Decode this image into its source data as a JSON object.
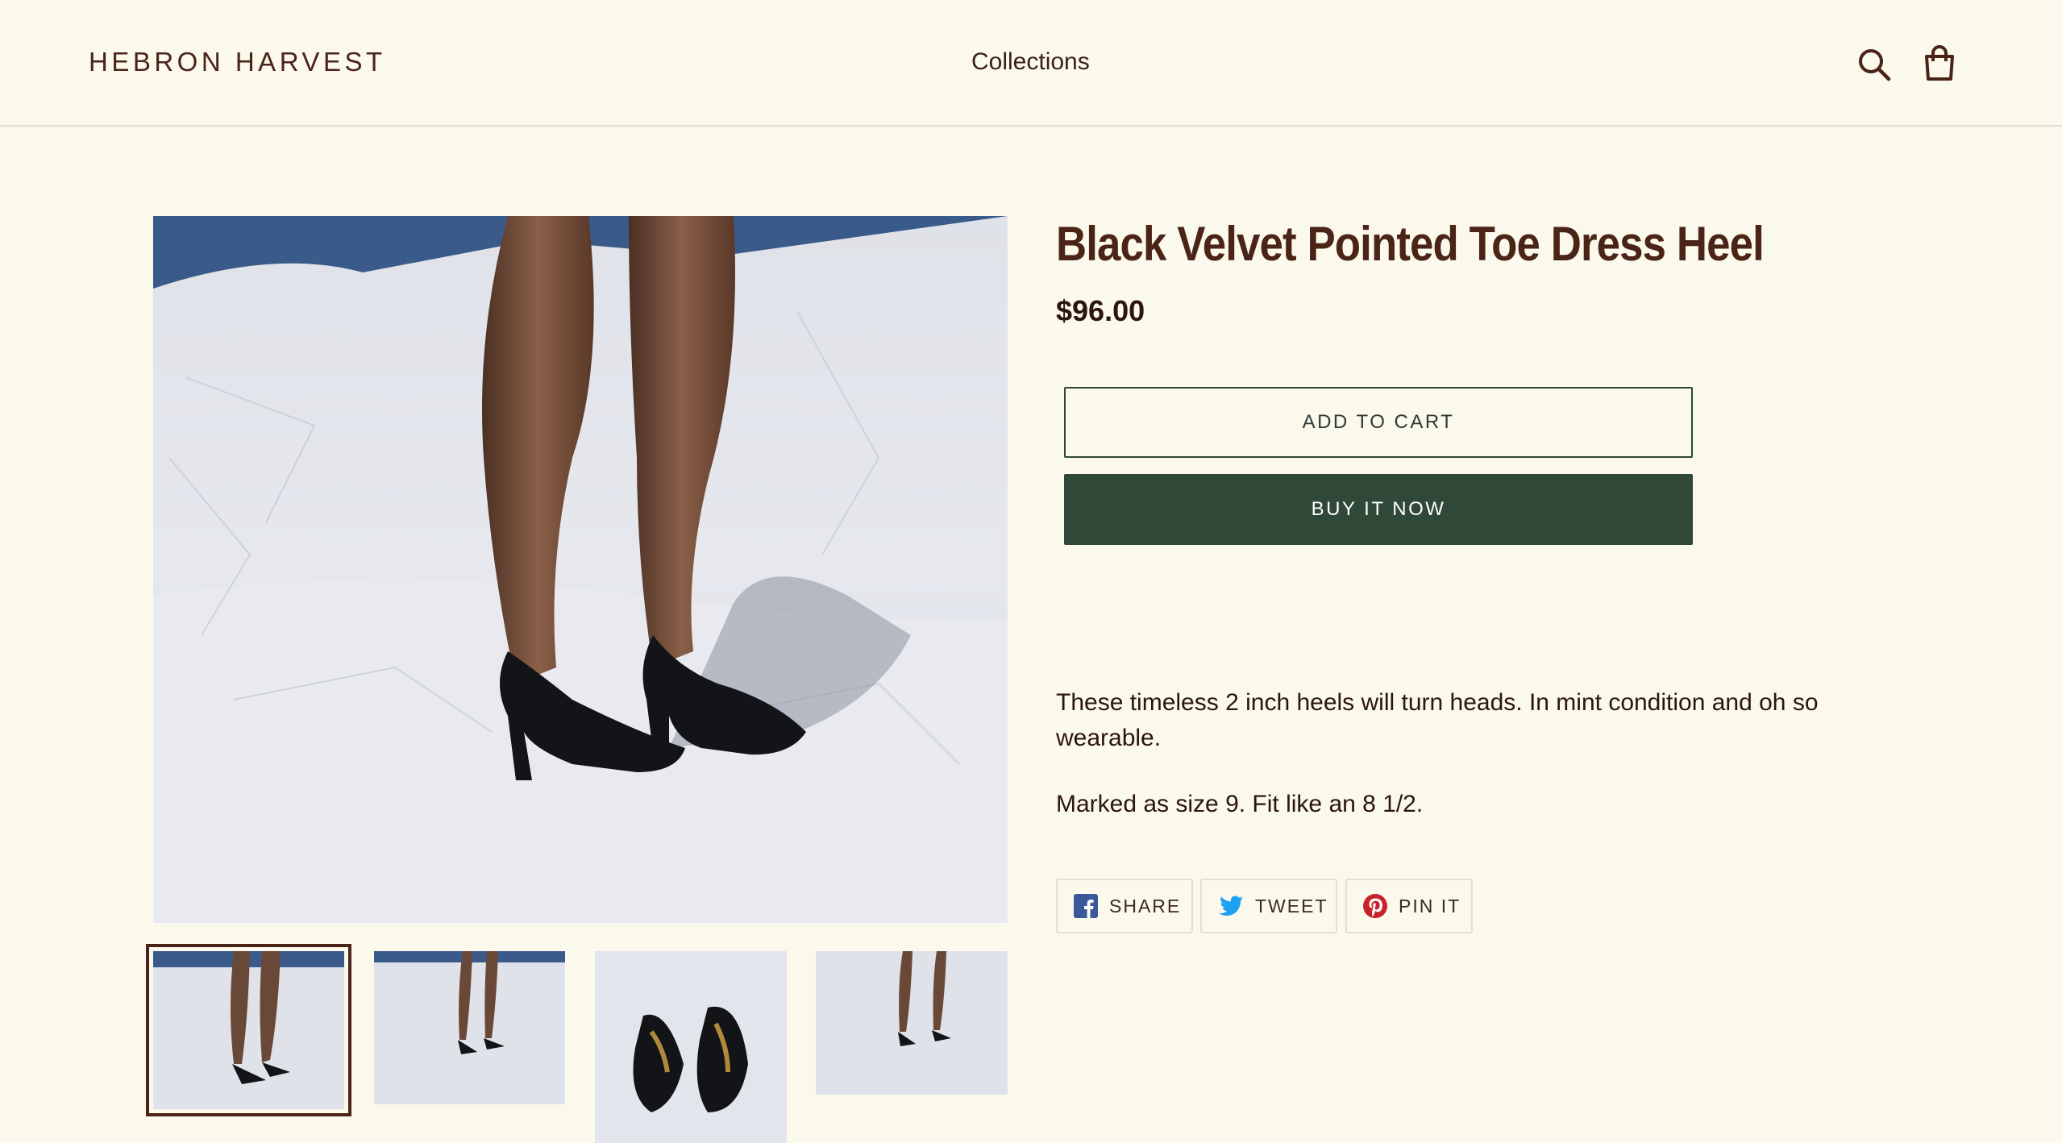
{
  "header": {
    "logo": "HEBRON HARVEST",
    "nav": [
      "Collections"
    ]
  },
  "product": {
    "title": "Black Velvet Pointed Toe Dress Heel",
    "price": "$96.00",
    "add_to_cart": "ADD TO CART",
    "buy_now": "BUY IT NOW",
    "description": [
      "These timeless 2 inch heels will turn heads. In mint condition and oh so wearable.",
      "Marked as size 9. Fit like an 8 1/2."
    ]
  },
  "share": {
    "facebook": "SHARE",
    "twitter": "TWEET",
    "pinterest": "PIN IT"
  },
  "colors": {
    "background": "#fbf8ec",
    "brand_brown": "#4a2417",
    "buy_button": "#304838",
    "facebook": "#3b5998",
    "twitter": "#1da1f2",
    "pinterest": "#c8232c"
  },
  "icons": [
    "search-icon",
    "cart-icon",
    "facebook-icon",
    "twitter-icon",
    "pinterest-icon"
  ]
}
